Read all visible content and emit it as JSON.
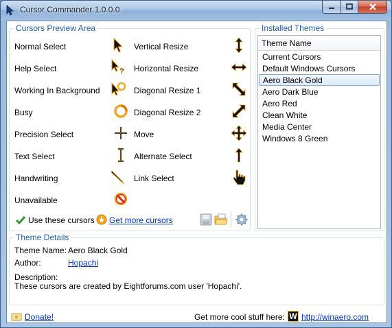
{
  "window": {
    "title": "Cursor Commander 1.0.0.0"
  },
  "preview": {
    "legend": "Cursors Preview Area",
    "left_column": [
      {
        "label": "Normal Select",
        "icon": "arrow-cursor-icon"
      },
      {
        "label": "Help Select",
        "icon": "help-cursor-icon"
      },
      {
        "label": "Working In Background",
        "icon": "working-cursor-icon"
      },
      {
        "label": "Busy",
        "icon": "busy-cursor-icon"
      },
      {
        "label": "Precision Select",
        "icon": "crosshair-cursor-icon"
      },
      {
        "label": "Text Select",
        "icon": "ibeam-cursor-icon"
      },
      {
        "label": "Handwriting",
        "icon": "pen-cursor-icon"
      },
      {
        "label": "Unavailable",
        "icon": "unavailable-cursor-icon"
      }
    ],
    "right_column": [
      {
        "label": "Vertical Resize",
        "icon": "vertical-resize-icon"
      },
      {
        "label": "Horizontal Resize",
        "icon": "horizontal-resize-icon"
      },
      {
        "label": "Diagonal Resize 1",
        "icon": "diagonal-resize-1-icon"
      },
      {
        "label": "Diagonal Resize 2",
        "icon": "diagonal-resize-2-icon"
      },
      {
        "label": "Move",
        "icon": "move-cursor-icon"
      },
      {
        "label": "Alternate Select",
        "icon": "alternate-select-icon"
      },
      {
        "label": "Link Select",
        "icon": "hand-cursor-icon"
      }
    ],
    "use_label": "Use these cursors",
    "get_more_label": "Get more cursors"
  },
  "themes": {
    "legend": "Installed Themes",
    "column_header": "Theme Name",
    "items": [
      "Current Cursors",
      "Default Windows Cursors",
      "Aero Black Gold",
      "Aero Dark Blue",
      "Aero Red",
      "Clean White",
      "Media Center",
      "Windows 8 Green"
    ],
    "selected": "Aero Black Gold"
  },
  "details": {
    "legend": "Theme Details",
    "name_label": "Theme Name:",
    "name_value": "Aero Black Gold",
    "author_label": "Author:",
    "author_value": "Hopachi",
    "description_label": "Description:",
    "description_value": "These cursors are created by Eightforums.com user 'Hopachi'."
  },
  "footer": {
    "donate_label": "Donate!",
    "more_stuff_label": "Get more cool stuff here:",
    "site_link": "http://winaero.com",
    "logo_letter": "W"
  },
  "colors": {
    "legend_blue": "#1f5fb0",
    "link_blue": "#0033cc",
    "cursor_gold": "#f5a623",
    "selection_border": "#84acdd"
  }
}
